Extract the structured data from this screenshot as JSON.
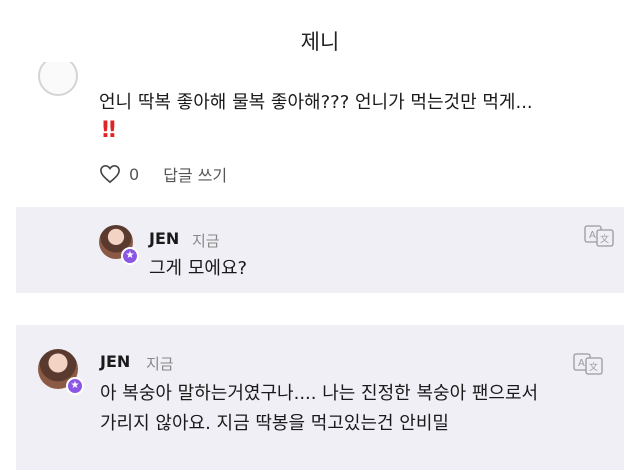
{
  "header": {
    "title": "제니"
  },
  "comment": {
    "text": "언니 딱복 좋아해 물복 좋아해??? 언니가 먹는것만 먹게...",
    "emoji": "‼",
    "like_count": "0",
    "reply_label": "답글 쓰기"
  },
  "replies": [
    {
      "author": "JEN",
      "time": "지금",
      "text": "그게 모에요?"
    },
    {
      "author": "JEN",
      "time": "지금",
      "text_line1": "아 복숭아 말하는거였구나.... 나는 진정한 복숭아 팬으로서",
      "text_line2": "가리지 않아요. 지금 딱봉을 먹고있는건 안비밀"
    }
  ],
  "colors": {
    "badge": "#8b56e6",
    "reply_bg": "#f1eff6",
    "alarm": "#e02424"
  },
  "icons": {
    "like": "heart-icon",
    "translate": "translate-icon",
    "badge": "star-icon"
  }
}
